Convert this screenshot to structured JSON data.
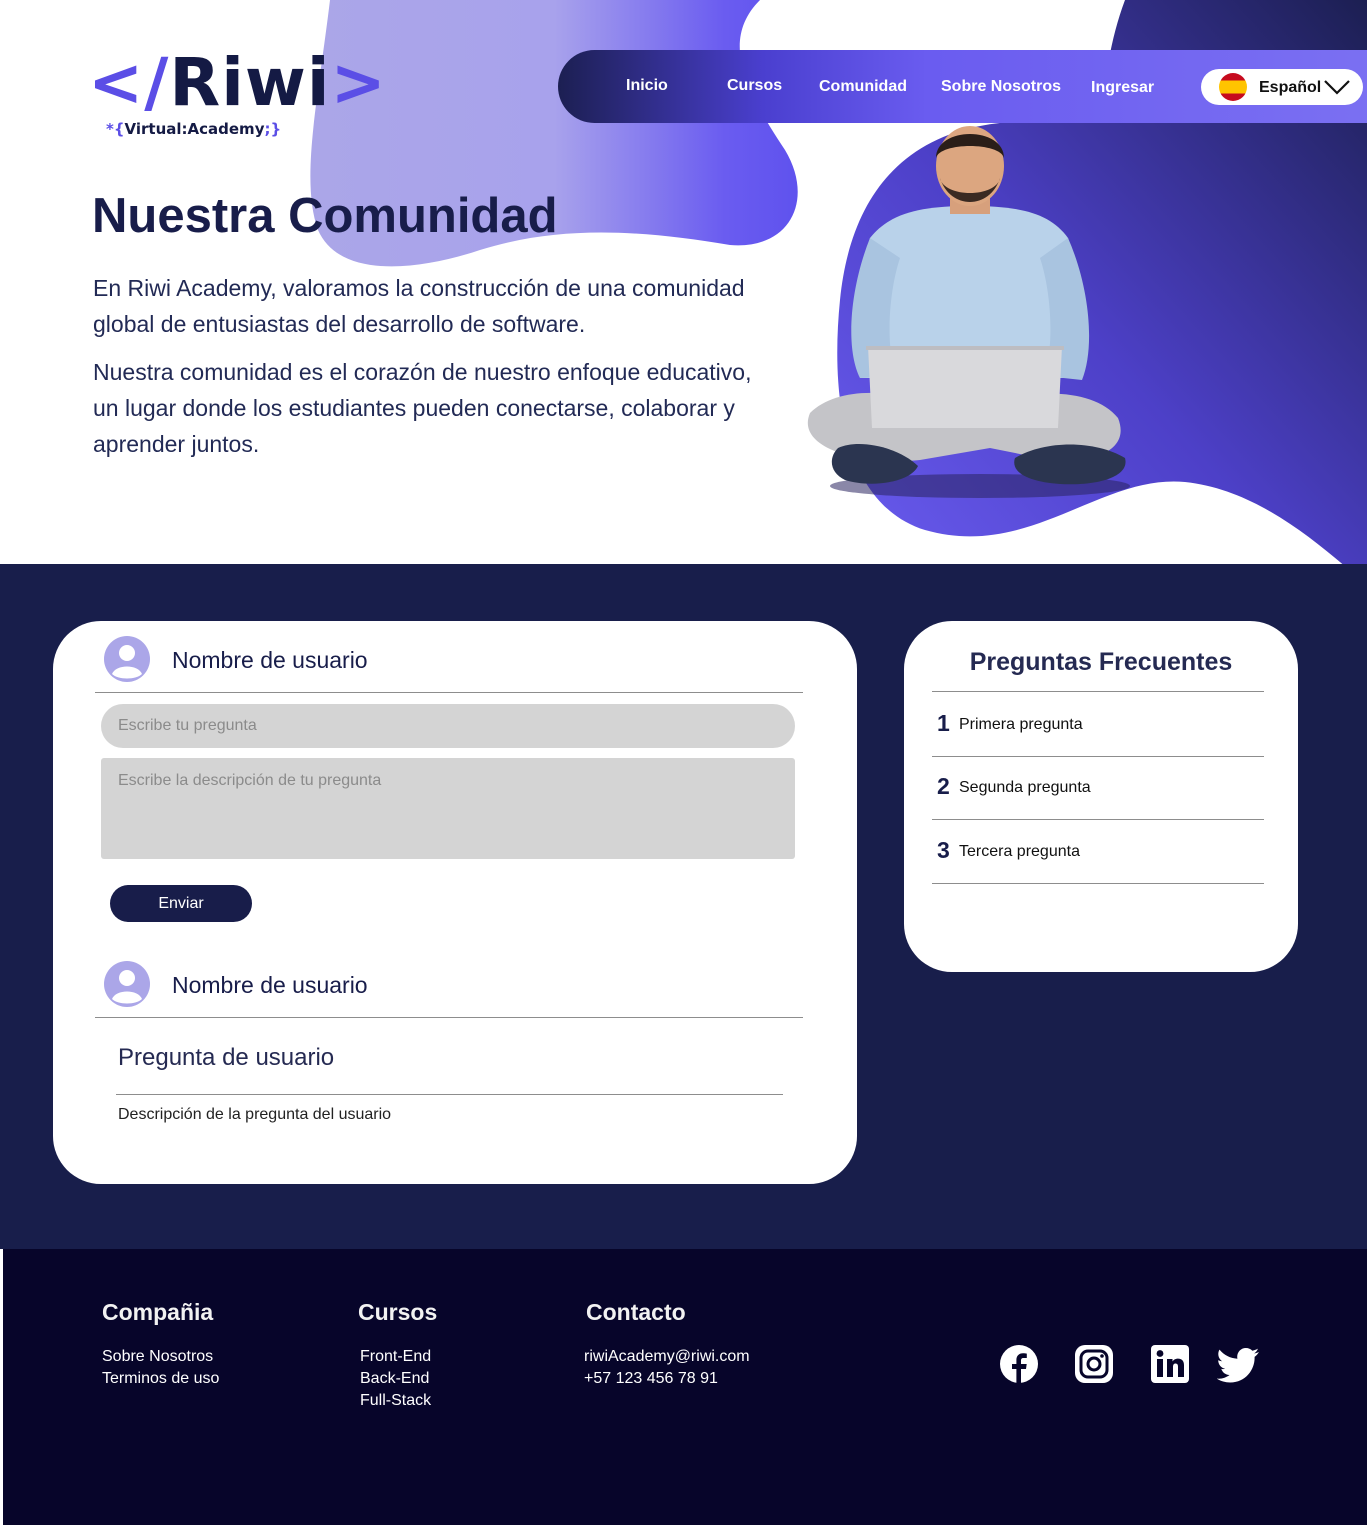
{
  "brand": {
    "logo_open": "</",
    "logo_name": "Riwi",
    "logo_close": ">",
    "tagline_open": "*{",
    "tagline_text": "Virtual:Academy",
    "tagline_close": ";}"
  },
  "nav": {
    "items": [
      {
        "label": "Inicio"
      },
      {
        "label": "Cursos"
      },
      {
        "label": "Comunidad"
      },
      {
        "label": "Sobre Nosotros"
      },
      {
        "label": "Ingresar"
      }
    ],
    "language": "Español"
  },
  "hero": {
    "title": "Nuestra Comunidad",
    "paragraph_1": "En Riwi Academy, valoramos la construcción de una comunidad global de entusiastas del desarrollo de software.",
    "paragraph_2": "Nuestra comunidad es el corazón de nuestro enfoque educativo, un lugar donde los estudiantes pueden conectarse, colaborar y aprender juntos."
  },
  "question_form": {
    "username": "Nombre de usuario",
    "question_placeholder": "Escribe tu pregunta",
    "description_placeholder": "Escribe la descripción de tu pregunta",
    "submit_label": "Enviar"
  },
  "user_post": {
    "username": "Nombre de usuario",
    "question": "Pregunta de usuario",
    "description": "Descripción de la pregunta del usuario"
  },
  "faq": {
    "title": "Preguntas Frecuentes",
    "items": [
      {
        "number": "1",
        "label": "Primera pregunta"
      },
      {
        "number": "2",
        "label": "Segunda pregunta"
      },
      {
        "number": "3",
        "label": "Tercera pregunta"
      }
    ]
  },
  "footer": {
    "company": {
      "heading": "Compañia",
      "links": [
        "Sobre Nosotros",
        "Terminos de uso"
      ]
    },
    "courses": {
      "heading": "Cursos",
      "links": [
        "Front-End",
        "Back-End",
        "Full-Stack"
      ]
    },
    "contact": {
      "heading": "Contacto",
      "email": "riwiAcademy@riwi.com",
      "phone": "+57 123 456 78 91"
    },
    "social_icons": [
      "facebook-icon",
      "instagram-icon",
      "linkedin-icon",
      "twitter-icon"
    ]
  },
  "colors": {
    "navy": "#181e4b",
    "footer": "#07052a",
    "accent": "#6a5cf0",
    "lavender": "#aaa5e9"
  }
}
